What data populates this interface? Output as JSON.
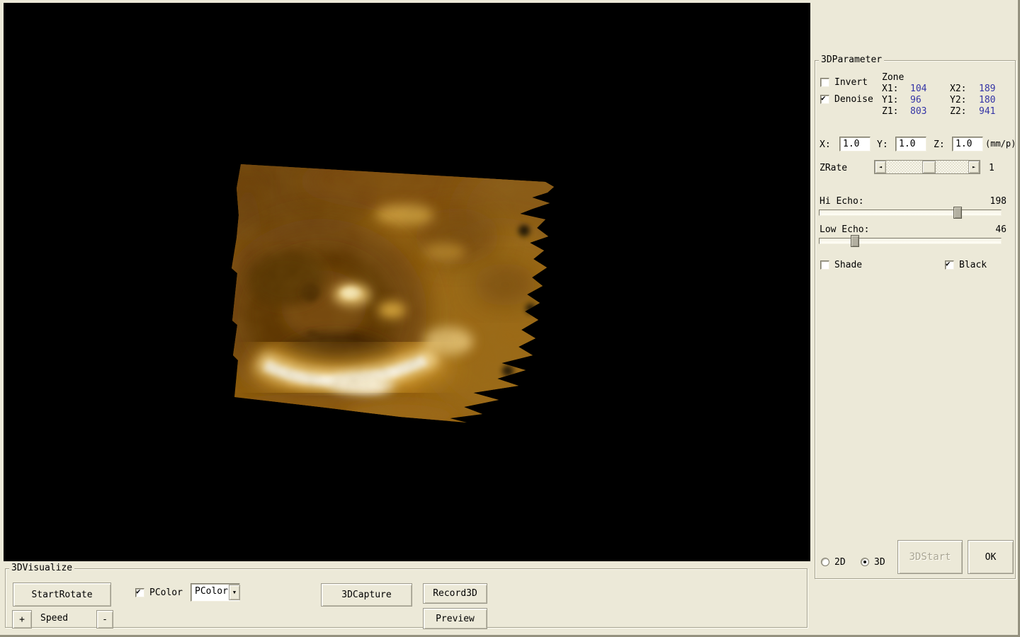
{
  "window": {
    "bg": "#ece9d8",
    "viewport_bg": "#000000",
    "value_color": "#3434a6"
  },
  "param_panel": {
    "title": "3DParameter",
    "invert": {
      "label": "Invert",
      "checked": false
    },
    "denoise": {
      "label": "Denoise",
      "checked": true
    },
    "zone": {
      "title": "Zone",
      "x1_label": "X1:",
      "x1": "104",
      "x2_label": "X2:",
      "x2": "189",
      "y1_label": "Y1:",
      "y1": "96",
      "y2_label": "Y2:",
      "y2": "180",
      "z1_label": "Z1:",
      "z1": "803",
      "z2_label": "Z2:",
      "z2": "941"
    },
    "scale": {
      "x_label": "X:",
      "x_value": "1.0",
      "y_label": "Y:",
      "y_value": "1.0",
      "z_label": "Z:",
      "z_value": "1.0",
      "unit": "(mm/p)"
    },
    "zrate": {
      "label": "ZRate",
      "value": "1"
    },
    "hi_echo": {
      "label": "Hi Echo:",
      "value": 198,
      "max": 255
    },
    "low_echo": {
      "label": "Low Echo:",
      "value": 46,
      "max": 255
    },
    "shade": {
      "label": "Shade",
      "checked": false
    },
    "black": {
      "label": "Black",
      "checked": true
    },
    "mode_2d": {
      "label": "2D",
      "selected": false
    },
    "mode_3d": {
      "label": "3D",
      "selected": true
    },
    "start3d_button": {
      "label": "3DStart",
      "enabled": false
    },
    "ok_button": {
      "label": "OK"
    }
  },
  "visualize_panel": {
    "title": "3DVisualize",
    "start_rotate_button": "StartRotate",
    "pcolor_checkbox": {
      "label": "PColor",
      "checked": true
    },
    "pcolor_dropdown": {
      "value": "PColor"
    },
    "speed_plus": "+",
    "speed_label": "Speed",
    "speed_minus": "-",
    "capture_button": "3DCapture",
    "record_button": "Record3D",
    "preview_button": "Preview"
  }
}
